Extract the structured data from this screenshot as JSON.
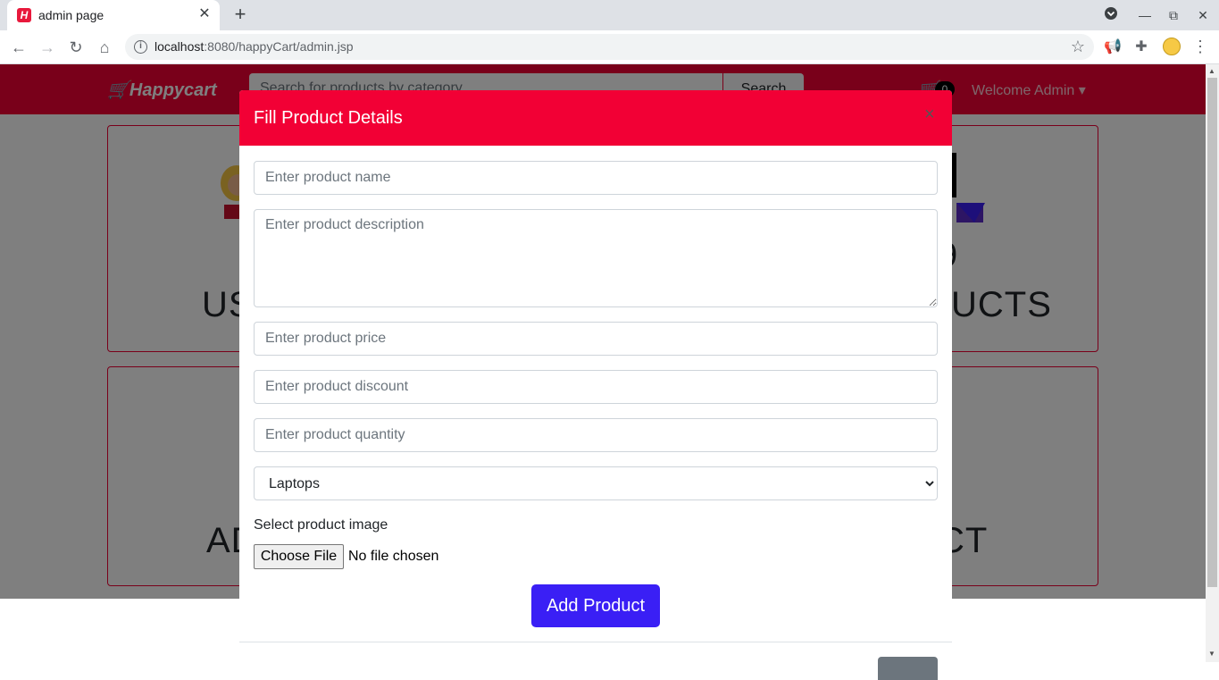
{
  "browser": {
    "tab_title": "admin page",
    "favicon_letter": "H",
    "url_host": "localhost",
    "url_rest": ":8080/happyCart/admin.jsp"
  },
  "navbar": {
    "brand": "Happycart",
    "search_placeholder": "Search for products by category",
    "search_label": "Search",
    "cart_count": "0",
    "welcome": "Welcome Admin"
  },
  "cards": [
    {
      "number": "",
      "title": "US"
    },
    {
      "number": "9",
      "title": "UCTS"
    },
    {
      "title": "AD"
    },
    {
      "title": "CT"
    }
  ],
  "modal": {
    "title": "Fill Product Details",
    "close": "×",
    "name_placeholder": "Enter product name",
    "description_placeholder": "Enter product description",
    "price_placeholder": "Enter product price",
    "discount_placeholder": "Enter product discount",
    "quantity_placeholder": "Enter product quantity",
    "category_selected": "Laptops",
    "image_label": "Select product image",
    "file_button": "Choose File",
    "file_status": "No file chosen",
    "submit": "Add Product"
  },
  "colors": {
    "brand_red": "#f20035",
    "submit_blue": "#3a1ff5"
  }
}
